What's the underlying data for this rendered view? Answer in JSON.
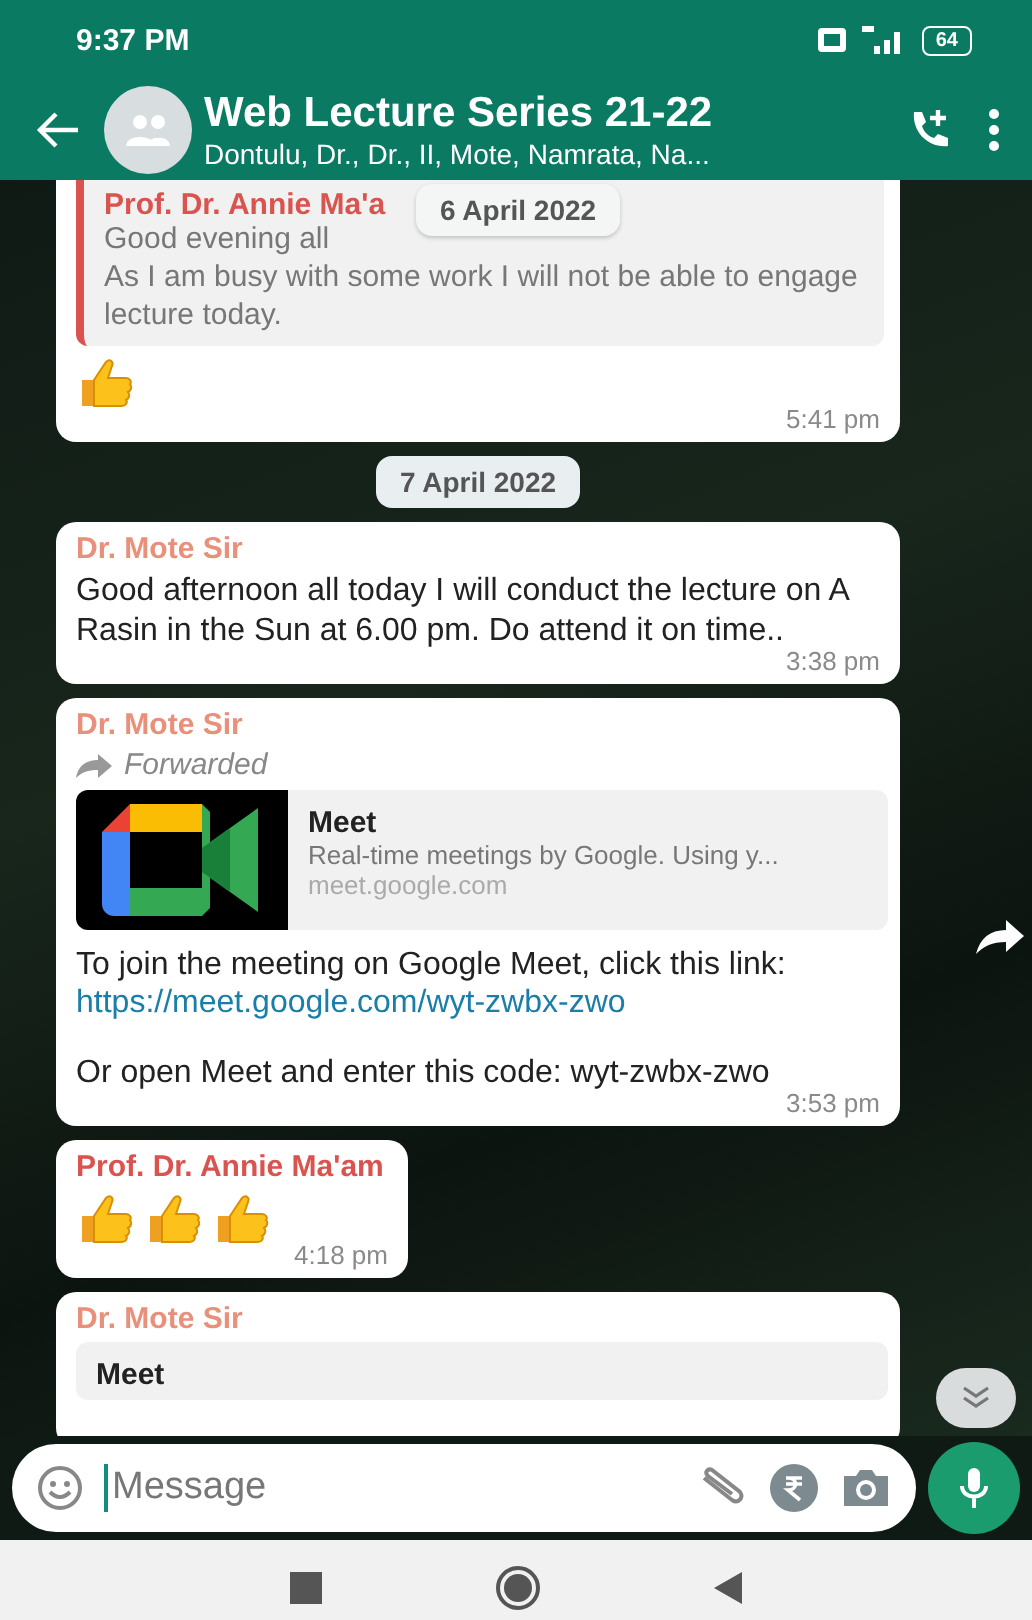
{
  "status_bar": {
    "time": "9:37 PM",
    "battery": "64"
  },
  "header": {
    "title": "Web Lecture Series 21-22",
    "subtitle": "Dontulu, Dr., Dr., II, Mote, Namrata, Na..."
  },
  "floating_date": "6 April 2022",
  "messages": [
    {
      "kind": "bubble",
      "cut_top": true,
      "forwarded": false,
      "quote": {
        "author": "Prof. Dr. Annie Ma'a",
        "text": "Good evening all\nAs I am busy with some work  I will not be able to engage lecture today.",
        "color": "#d9534f"
      },
      "reactions": [
        {
          "kind": "thumbs-up"
        }
      ],
      "time": "5:41 pm"
    },
    {
      "kind": "date",
      "text": "7 April 2022"
    },
    {
      "kind": "bubble",
      "cut_top": false,
      "forwarded": false,
      "sender": "Dr. Mote Sir",
      "color": "#e8907a",
      "body": [
        {
          "kind": "text",
          "text": "Good afternoon all today I will conduct the lecture on A Rasin in the Sun at 6.00 pm. Do attend it on time.."
        }
      ],
      "time": "3:38 pm"
    },
    {
      "kind": "bubble",
      "cut_top": false,
      "forwarded": true,
      "forwarded_label": "Forwarded",
      "share": true,
      "sender": "Dr. Mote Sir",
      "color": "#e8907a",
      "preview": {
        "title": "Meet",
        "description": "Real-time meetings by Google. Using y...",
        "domain": "meet.google.com"
      },
      "body": [
        {
          "kind": "text",
          "text": "To join the meeting on Google Meet, click this link:"
        },
        {
          "kind": "link",
          "text": "https://meet.google.com/wyt-zwbx-zwo"
        },
        {
          "kind": "text",
          "text": "Or open Meet and enter this code: wyt-zwbx-zwo"
        }
      ],
      "time": "3:53 pm"
    },
    {
      "kind": "bubble",
      "cut_top": false,
      "forwarded": false,
      "sender": "Prof. Dr. Annie Ma'am",
      "color": "#d9534f",
      "reactions": [
        {
          "kind": "thumbs-up"
        },
        {
          "kind": "thumbs-up"
        },
        {
          "kind": "thumbs-up"
        }
      ],
      "time": "4:18 pm"
    },
    {
      "kind": "bubble",
      "cut_top": false,
      "forwarded": false,
      "sender": "Dr. Mote Sir",
      "color": "#e8907a",
      "preview": {
        "title": "Meet"
      }
    }
  ],
  "composer": {
    "placeholder": "Message"
  }
}
